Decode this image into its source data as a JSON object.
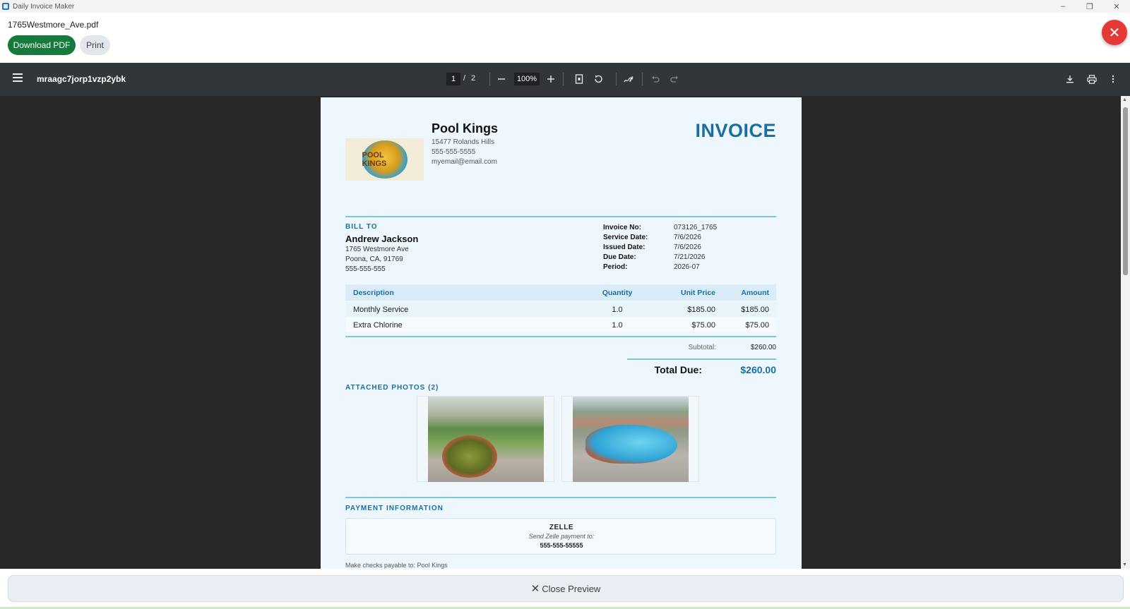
{
  "window": {
    "title": "Daily Invoice Maker",
    "minimize": "–",
    "restore": "❐",
    "close": "✕"
  },
  "header": {
    "filename": "1765Westmore_Ave.pdf",
    "download_label": "Download PDF",
    "print_label": "Print",
    "close_symbol": "✕"
  },
  "viewer": {
    "doc_name": "mraagc7jorp1vzp2ybk",
    "current_page": "1",
    "page_sep": "/",
    "total_pages": "2",
    "zoom": "100%",
    "icons": [
      "menu-icon",
      "zoom-out-icon",
      "zoom-in-icon",
      "fit-page-icon",
      "rotate-icon",
      "annotate-icon",
      "undo-icon",
      "redo-icon",
      "download-icon",
      "print-icon",
      "more-icon"
    ]
  },
  "invoice": {
    "business": {
      "name": "Pool Kings",
      "address": "15477 Rolands Hills",
      "phone": "555-555-5555",
      "email": "myemail@email.com",
      "logo_text": "POOL KINGS"
    },
    "title": "INVOICE",
    "bill_to_label": "BILL TO",
    "client": {
      "name": "Andrew Jackson",
      "address1": "1765 Westmore Ave",
      "address2": "Poona, CA, 91769",
      "phone": "555-555-555"
    },
    "meta": [
      {
        "label": "Invoice No:",
        "value": "073126_1765"
      },
      {
        "label": "Service Date:",
        "value": "7/6/2026"
      },
      {
        "label": "Issued Date:",
        "value": "7/6/2026"
      },
      {
        "label": "Due Date:",
        "value": "7/21/2026"
      },
      {
        "label": "Period:",
        "value": "2026-07"
      }
    ],
    "table": {
      "headers": {
        "description": "Description",
        "quantity": "Quantity",
        "unit_price": "Unit Price",
        "amount": "Amount"
      },
      "rows": [
        {
          "description": "Monthly Service",
          "quantity": "1.0",
          "unit_price": "$185.00",
          "amount": "$185.00"
        },
        {
          "description": "Extra Chlorine",
          "quantity": "1.0",
          "unit_price": "$75.00",
          "amount": "$75.00"
        }
      ]
    },
    "subtotal_label": "Subtotal:",
    "subtotal_value": "$260.00",
    "total_label": "Total Due:",
    "total_value": "$260.00",
    "photos_label": "ATTACHED PHOTOS (2)",
    "payment_label": "PAYMENT INFORMATION",
    "payment": {
      "method": "ZELLE",
      "instructions": "Send Zelle payment to:",
      "number": "555-555-55555"
    },
    "checks_note": "Make checks payable to: Pool Kings"
  },
  "footer": {
    "close_preview_label": "Close Preview",
    "close_symbol": "✕"
  },
  "colors": {
    "accent": "#1a6fa0",
    "download_button": "#167a3c",
    "close_button": "#e53935",
    "viewer_bar": "#323639"
  }
}
